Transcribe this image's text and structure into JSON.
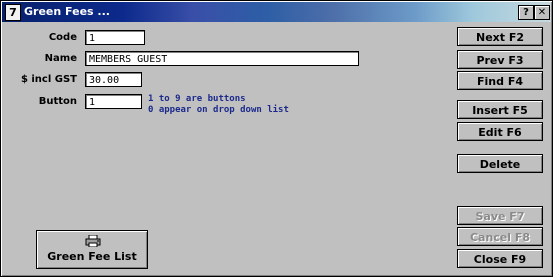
{
  "window": {
    "title": "Green Fees ...",
    "app_icon_glyph": "7",
    "help_glyph": "?",
    "close_glyph": "✕"
  },
  "form": {
    "code": {
      "label": "Code",
      "value": "1"
    },
    "name": {
      "label": "Name",
      "value": "MEMBERS GUEST"
    },
    "price": {
      "label": "$ incl GST",
      "value": "30.00"
    },
    "button": {
      "label": "Button",
      "value": "1"
    },
    "hint_line1": "1 to 9 are buttons",
    "hint_line2": "0 appear on drop down list"
  },
  "buttons": {
    "next": "Next F2",
    "prev": "Prev F3",
    "find": "Find F4",
    "insert": "Insert F5",
    "edit": "Edit F6",
    "delete": "Delete",
    "save": "Save F7",
    "cancel": "Cancel F8",
    "close": "Close F9",
    "list": "Green Fee List"
  },
  "colors": {
    "window_bg": "#c0c0c0",
    "hint_text": "#1c2a8c",
    "disabled_text": "#8a8a8a"
  }
}
